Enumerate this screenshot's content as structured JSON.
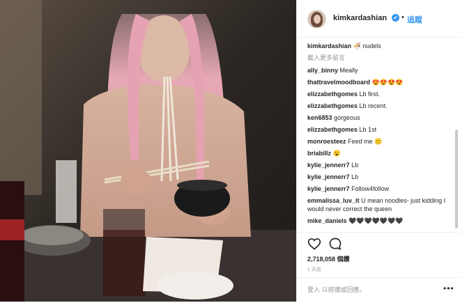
{
  "post": {
    "username": "kimkardashian",
    "verified_glyph": "✔",
    "dot": "•",
    "follow_label": "追蹤",
    "caption_user": "kimkardashian",
    "caption_text": "🍜 nudels",
    "load_more": "載入更多留言",
    "comments": [
      {
        "user": "ally_binny",
        "text": "Meally"
      },
      {
        "user": "thattravelmoodboard",
        "text": "😍😍😍😍"
      },
      {
        "user": "elizzabethgomes",
        "text": "Lb first."
      },
      {
        "user": "elizzabethgomes",
        "text": "Lb recent."
      },
      {
        "user": "ken6853",
        "text": "gorgeous"
      },
      {
        "user": "elizzabethgomes",
        "text": "Lb 1st"
      },
      {
        "user": "monroesteez",
        "text": "Feed me 🙂"
      },
      {
        "user": "briabillz",
        "text": "😮"
      },
      {
        "user": "kylie_jennerr7",
        "text": "Lb"
      },
      {
        "user": "kylie_jennerr7",
        "text": "Lb"
      },
      {
        "user": "kylie_jennerr7",
        "text": "Follow4follow"
      },
      {
        "user": "emmalissa_luv_it",
        "text": "U mean noodles- just kidding I would never correct the queen"
      },
      {
        "user": "mike_daniels",
        "text": "🖤🖤🖤🖤🖤🖤🖤"
      }
    ],
    "likes": "2,718,058 個讚",
    "time": "1 天前",
    "add_comment_placeholder": "登入 以按讚或回應。",
    "more_glyph": "•••"
  }
}
